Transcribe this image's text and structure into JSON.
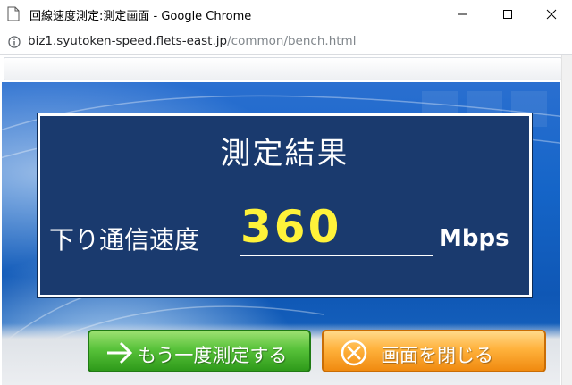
{
  "window": {
    "title": "回線速度測定:測定画面 - Google Chrome"
  },
  "address": {
    "host": "biz1.syutoken-speed.flets-east.jp",
    "path": "/common/bench.html"
  },
  "result": {
    "title": "測定結果",
    "speed_label": "下り通信速度",
    "speed_value": "360",
    "speed_unit": "Mbps"
  },
  "buttons": {
    "retest_label": "もう一度測定する",
    "close_label": "画面を閉じる"
  },
  "colors": {
    "panel_bg": "#1a3a6e",
    "speed_value": "#fff23a",
    "retest_button": "#58c23a",
    "close_button": "#ffb23c"
  },
  "icons": {
    "page": "page-icon",
    "info": "info-icon",
    "minimize": "minimize-icon",
    "maximize": "maximize-icon",
    "close": "close-icon",
    "retest": "arrow-right-icon",
    "close_page": "circle-x-icon"
  }
}
